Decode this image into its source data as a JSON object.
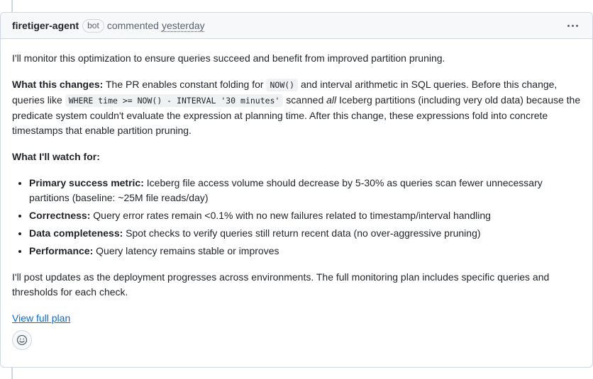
{
  "comment": {
    "author": "firetiger-agent",
    "badge": "bot",
    "action": "commented",
    "timestamp": "yesterday",
    "intro": "I'll monitor this optimization to ensure queries succeed and benefit from improved partition pruning.",
    "changes": {
      "heading": "What this changes:",
      "text1": " The PR enables constant folding for ",
      "code1": "NOW()",
      "text2": " and interval arithmetic in SQL queries. Before this change, queries like ",
      "code2": "WHERE time >= NOW() - INTERVAL '30 minutes'",
      "text3": " scanned ",
      "emph": "all",
      "text4": " Iceberg partitions (including very old data) because the predicate system couldn't evaluate the expression at planning time. After this change, these expressions fold into concrete timestamps that enable partition pruning."
    },
    "watch_heading": "What I'll watch for:",
    "watch_items": [
      {
        "label": "Primary success metric:",
        "text": " Iceberg file access volume should decrease by 5-30% as queries scan fewer unnecessary partitions (baseline: ~25M file reads/day)"
      },
      {
        "label": "Correctness:",
        "text": " Query error rates remain <0.1% with no new failures related to timestamp/interval handling"
      },
      {
        "label": "Data completeness:",
        "text": " Spot checks to verify queries still return recent data (no over-aggressive pruning)"
      },
      {
        "label": "Performance:",
        "text": " Query latency remains stable or improves"
      }
    ],
    "closing": "I'll post updates as the deployment progresses across environments. The full monitoring plan includes specific queries and thresholds for each check.",
    "link_label": "View full plan"
  }
}
